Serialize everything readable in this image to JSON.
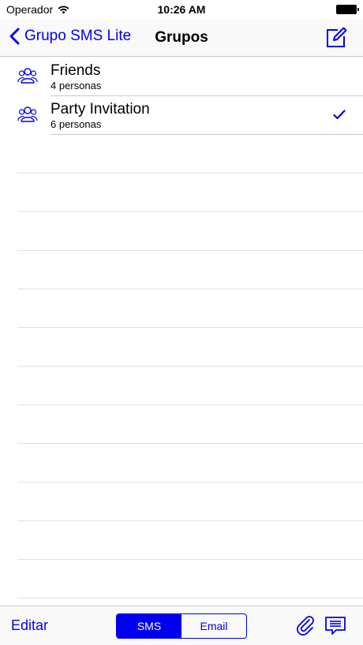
{
  "status_bar": {
    "carrier": "Operador",
    "time": "10:26 AM"
  },
  "nav": {
    "back_label": "Grupo SMS Lite",
    "title": "Grupos"
  },
  "groups": [
    {
      "name": "Friends",
      "count": "4 personas",
      "selected": false
    },
    {
      "name": "Party Invitation",
      "count": "6 personas",
      "selected": true
    }
  ],
  "toolbar": {
    "edit_label": "Editar",
    "segments": [
      "SMS",
      "Email"
    ],
    "active_segment": "SMS"
  },
  "icons": {
    "back": "chevron-left-icon",
    "compose": "compose-icon",
    "group": "group-people-icon",
    "check": "checkmark-icon",
    "attach": "paperclip-icon",
    "message": "message-template-icon",
    "wifi": "wifi-icon",
    "battery": "battery-icon"
  },
  "colors": {
    "accent": "#0000ee",
    "separator": "#c8c7cc"
  }
}
